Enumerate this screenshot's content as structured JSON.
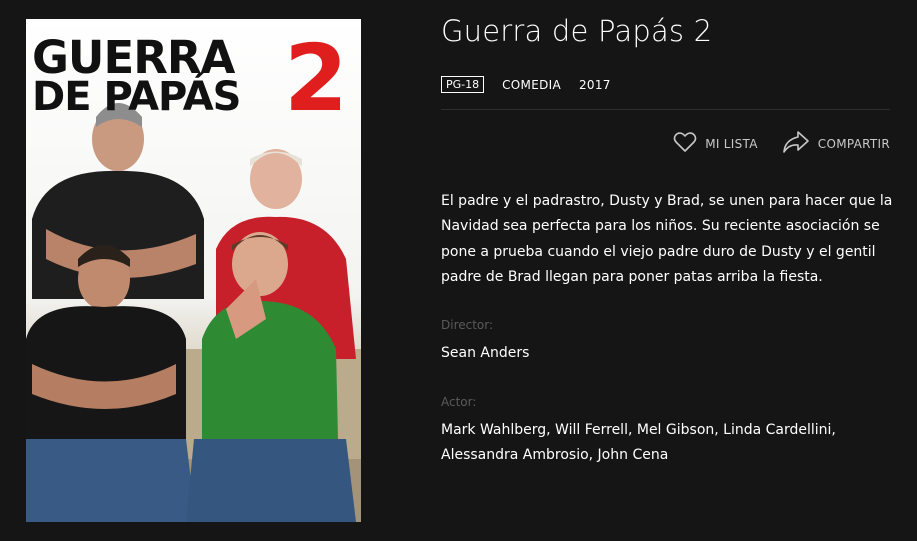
{
  "movie": {
    "poster": {
      "title_line1": "GUERRA",
      "title_line2": "DE PAPÁS",
      "title_number": "2"
    },
    "title": "Guerra de Papás 2",
    "rating": "PG-18",
    "genre": "COMEDIA",
    "year": "2017",
    "actions": {
      "my_list": "MI LISTA",
      "share": "COMPARTIR"
    },
    "description": "El padre y el padrastro, Dusty y Brad, se unen para hacer que la Navidad sea perfecta para los niños. Su reciente asociación se pone a prueba cuando el viejo padre duro de Dusty y el gentil padre de Brad llegan para poner patas arriba la fiesta.",
    "director_label": "Director:",
    "director": "Sean Anders",
    "actor_label": "Actor:",
    "actors": "Mark Wahlberg, Will Ferrell, Mel Gibson, Linda Cardellini, Alessandra Ambrosio, John Cena"
  },
  "colors": {
    "background": "#151515",
    "text": "#ffffff",
    "muted": "#5a5a5a",
    "poster_accent": "#e01e1e"
  },
  "icons": {
    "my_list": "heart-icon",
    "share": "share-icon"
  }
}
